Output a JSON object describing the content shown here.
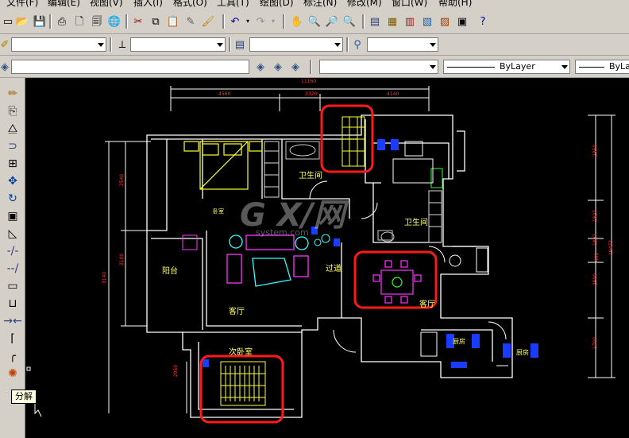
{
  "menu": [
    "文件(F)",
    "编辑(E)",
    "视图(V)",
    "插入(I)",
    "格式(O)",
    "工具(T)",
    "绘图(D)",
    "标注(N)",
    "修改(M)",
    "窗口(W)",
    "帮助(H)"
  ],
  "toolbar3": {
    "linetype_label": "ByLayer",
    "lineweight_label": "ByLa"
  },
  "tooltip": "分解",
  "drawing": {
    "dims_top": [
      "11160",
      "4560",
      "2320",
      "4140"
    ],
    "dims_left": [
      "2540",
      "3100",
      "3140"
    ],
    "dims_right": [
      "2350",
      "1827",
      "2900",
      "1827",
      "400",
      "1700",
      "19477"
    ],
    "dims_bottom": [
      "2950"
    ],
    "rooms": {
      "bathroom1": "卫生间",
      "bathroom2": "卫生间",
      "bedroom_label": "卧室",
      "balcony": "阳台",
      "living": "客厅",
      "corridor": "过道",
      "dining": "客厅",
      "second_bedroom": "次卧室",
      "kitchen1": "厨房",
      "kitchen2": "厨房"
    },
    "watermark": "G X/网",
    "watermark_sub": "system.com"
  },
  "colors": {
    "highlight": "#ff1a1a",
    "dimension": "#ff3333",
    "wall": "#ffffff",
    "furniture_magenta": "#ff33ff",
    "furniture_yellow": "#ffff33",
    "furniture_blue": "#1a3cff",
    "furniture_green": "#33ff33",
    "furniture_cyan": "#33ffff"
  }
}
